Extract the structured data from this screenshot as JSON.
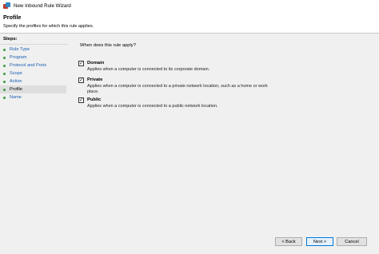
{
  "window": {
    "title": "New Inbound Rule Wizard"
  },
  "header": {
    "title": "Profile",
    "description": "Specify the profiles for which this rule applies."
  },
  "steps": {
    "title": "Steps:",
    "items": [
      "Rule Type",
      "Program",
      "Protocol and Ports",
      "Scope",
      "Action",
      "Profile",
      "Name"
    ],
    "current": "Profile"
  },
  "panel": {
    "question": "When does this rule apply?",
    "options": [
      {
        "label": "Domain",
        "checked": true,
        "description": "Applies when a computer is connected to its corporate domain."
      },
      {
        "label": "Private",
        "checked": true,
        "description": "Applies when a computer is connected to a private network location, such as a home or work place."
      },
      {
        "label": "Public",
        "checked": true,
        "description": "Applies when a computer is connected to a public network location."
      }
    ]
  },
  "buttons": {
    "back": "< Back",
    "next": "Next >",
    "cancel": "Cancel"
  },
  "colors": {
    "link": "#1a5fb4",
    "step_dot": "#3a9a3a",
    "primary_border": "#0078d7"
  }
}
